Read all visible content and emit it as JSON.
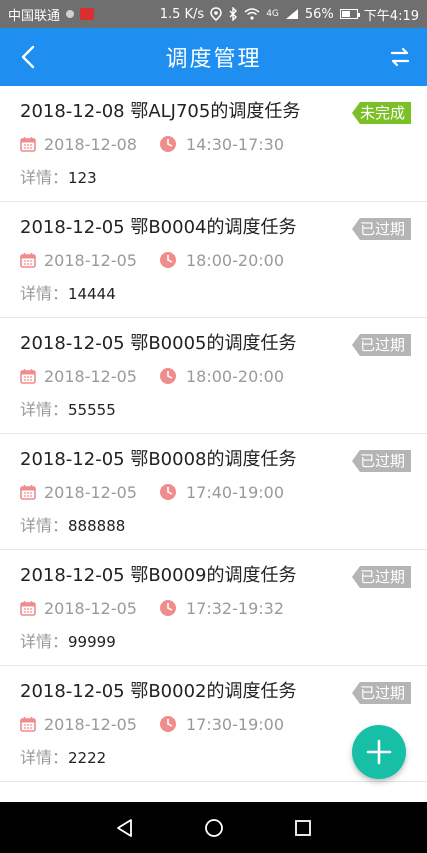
{
  "status_bar": {
    "carrier": "中国联通",
    "speed": "1.5 K/s",
    "signal": "4G",
    "battery_pct": "56%",
    "battery_level": 0.56,
    "time": "下午4:19"
  },
  "header": {
    "title": "调度管理"
  },
  "tasks": [
    {
      "title": "2018-12-08 鄂ALJ705的调度任务",
      "date": "2018-12-08",
      "time": "14:30-17:30",
      "detail_label": "详情：",
      "detail": "123",
      "status": "未完成",
      "status_type": "incomplete"
    },
    {
      "title": "2018-12-05 鄂B0004的调度任务",
      "date": "2018-12-05",
      "time": "18:00-20:00",
      "detail_label": "详情：",
      "detail": "14444",
      "status": "已过期",
      "status_type": "expired"
    },
    {
      "title": "2018-12-05 鄂B0005的调度任务",
      "date": "2018-12-05",
      "time": "18:00-20:00",
      "detail_label": "详情：",
      "detail": "55555",
      "status": "已过期",
      "status_type": "expired"
    },
    {
      "title": "2018-12-05 鄂B0008的调度任务",
      "date": "2018-12-05",
      "time": "17:40-19:00",
      "detail_label": "详情：",
      "detail": "888888",
      "status": "已过期",
      "status_type": "expired"
    },
    {
      "title": "2018-12-05 鄂B0009的调度任务",
      "date": "2018-12-05",
      "time": "17:32-19:32",
      "detail_label": "详情：",
      "detail": "99999",
      "status": "已过期",
      "status_type": "expired"
    },
    {
      "title": "2018-12-05 鄂B0002的调度任务",
      "date": "2018-12-05",
      "time": "17:30-19:00",
      "detail_label": "详情：",
      "detail": "2222",
      "status": "已过期",
      "status_type": "expired"
    }
  ],
  "colors": {
    "primary": "#1e8ff0",
    "incomplete": "#7cc028",
    "expired": "#b5b5b5",
    "fab": "#16bfa6",
    "icon": "#f08c8c"
  },
  "icons": {
    "back": "chevron-left-icon",
    "swap": "swap-arrows-icon",
    "date": "calendar-icon",
    "time": "clock-icon",
    "add": "plus-icon"
  }
}
